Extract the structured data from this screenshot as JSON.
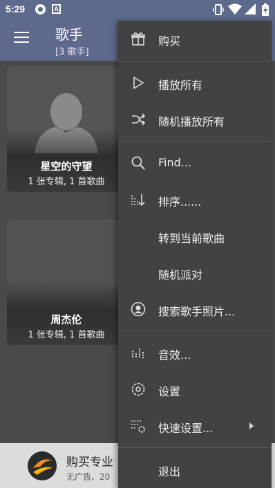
{
  "status_bar": {
    "time": "5:29",
    "icons": [
      "app-notification-icon",
      "a-icon",
      "vibrate-icon",
      "wifi-icon",
      "signal-icon",
      "battery-icon"
    ]
  },
  "app_bar": {
    "title": "歌手",
    "subtitle": "[3 歌手]",
    "icon": "hamburger-menu-icon"
  },
  "artists": [
    {
      "name": "星空的守望",
      "detail": "1 张专辑, 1 首歌曲"
    },
    {
      "name": "周杰伦",
      "detail": "1 张专辑, 1 首歌曲"
    }
  ],
  "promo": {
    "title": "购买专业",
    "subtitle": "无广告、20"
  },
  "menu": {
    "items": [
      {
        "label": "购买",
        "icon": "gift-icon"
      },
      {
        "label": "播放所有",
        "icon": "play-icon"
      },
      {
        "label": "随机播放所有",
        "icon": "shuffle-icon"
      },
      {
        "label": "Find...",
        "icon": "search-icon"
      },
      {
        "label": "排序......",
        "icon": "sort-icon"
      },
      {
        "label": "转到当前歌曲",
        "icon": ""
      },
      {
        "label": "随机派对",
        "icon": ""
      },
      {
        "label": "搜索歌手照片...",
        "icon": "account-circle-icon"
      },
      {
        "label": "音效...",
        "icon": "equalizer-icon"
      },
      {
        "label": "设置",
        "icon": "settings-icon"
      },
      {
        "label": "快速设置...",
        "icon": "quick-settings-icon"
      },
      {
        "label": "退出",
        "icon": ""
      }
    ]
  },
  "colors": {
    "app_bar": "#5e6a8c",
    "menu_bg": "#424242",
    "content_bg": "#4a4a4a"
  }
}
